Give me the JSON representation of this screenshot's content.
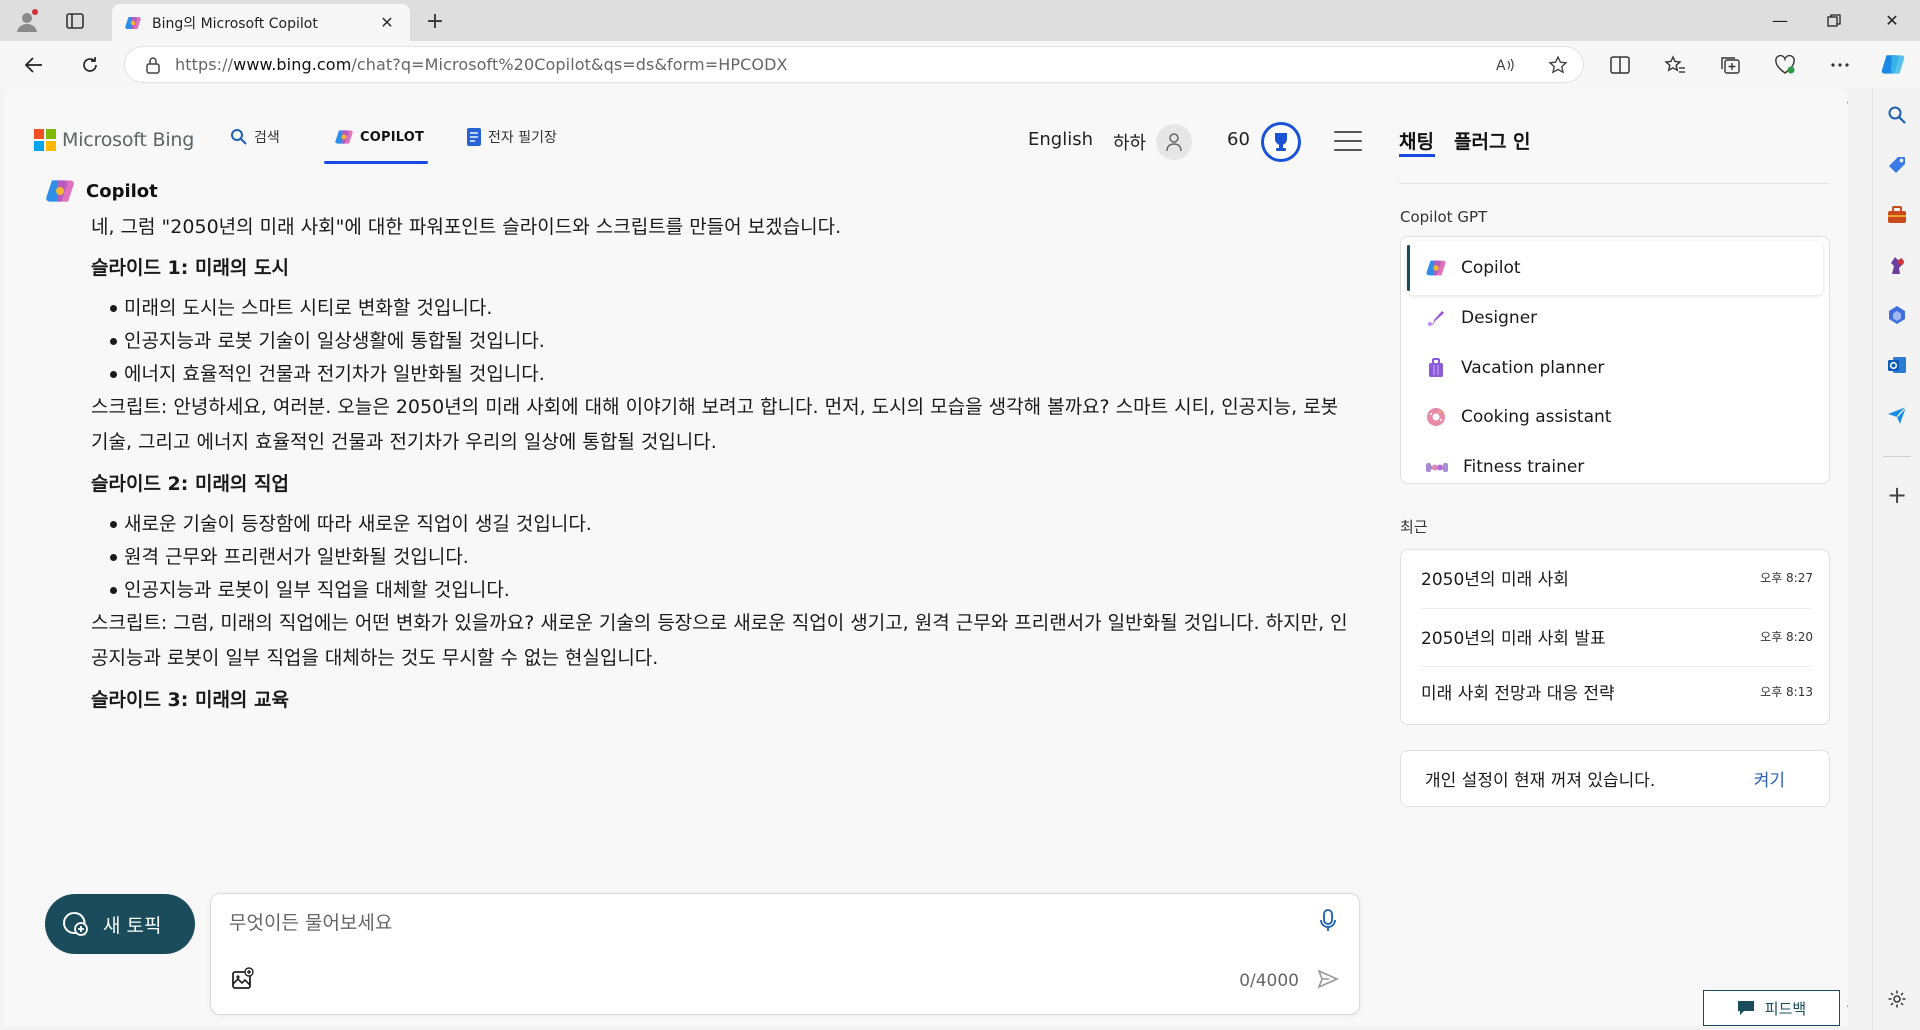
{
  "browser": {
    "tab_title": "Bing의 Microsoft Copilot",
    "url_prefix": "https://",
    "url_domain": "www.bing.com",
    "url_path": "/chat?q=Microsoft%20Copilot&qs=ds&form=HPCODX"
  },
  "header": {
    "logo_text": "Microsoft Bing",
    "nav": {
      "search": "검색",
      "copilot": "COPILOT",
      "notebook": "전자 필기장"
    },
    "language": "English",
    "user_name": "하하",
    "points": "60"
  },
  "chat": {
    "bot_name": "Copilot",
    "intro": "네, 그럼 \"2050년의 미래 사회\"에 대한 파워포인트 슬라이드와 스크립트를 만들어 보겠습니다.",
    "slide1_title": "슬라이드 1: 미래의 도시",
    "slide1_bullets": [
      "미래의 도시는 스마트 시티로 변화할 것입니다.",
      "인공지능과 로봇 기술이 일상생활에 통합될 것입니다.",
      "에너지 효율적인 건물과 전기차가 일반화될 것입니다."
    ],
    "slide1_script": "스크립트: 안녕하세요, 여러분. 오늘은 2050년의 미래 사회에 대해 이야기해 보려고 합니다. 먼저, 도시의 모습을 생각해 볼까요? 스마트 시티, 인공지능, 로봇 기술, 그리고 에너지 효율적인 건물과 전기차가 우리의 일상에 통합될 것입니다.",
    "slide2_title": "슬라이드 2: 미래의 직업",
    "slide2_bullets": [
      "새로운 기술이 등장함에 따라 새로운 직업이 생길 것입니다.",
      "원격 근무와 프리랜서가 일반화될 것입니다.",
      "인공지능과 로봇이 일부 직업을 대체할 것입니다."
    ],
    "slide2_script": "스크립트: 그럼, 미래의 직업에는 어떤 변화가 있을까요? 새로운 기술의 등장으로 새로운 직업이 생기고, 원격 근무와 프리랜서가 일반화될 것입니다. 하지만, 인공지능과 로봇이 일부 직업을 대체하는 것도 무시할 수 없는 현실입니다.",
    "slide3_title": "슬라이드 3: 미래의 교육"
  },
  "composer": {
    "new_topic": "새 토픽",
    "placeholder": "무엇이든 물어보세요",
    "char_count": "0/4000"
  },
  "right_panel": {
    "tabs": [
      "채팅",
      "플러그 인"
    ],
    "gpt_section": "Copilot GPT",
    "gpts": [
      "Copilot",
      "Designer",
      "Vacation planner",
      "Cooking assistant",
      "Fitness trainer"
    ],
    "recent_section": "최근",
    "recent": [
      {
        "title": "2050년의 미래 사회",
        "time": "오후 8:27"
      },
      {
        "title": "2050년의 미래 사회 발표",
        "time": "오후 8:20"
      },
      {
        "title": "미래 사회 전망과 대응 전략",
        "time": "오후 8:13"
      }
    ],
    "privacy_text": "개인 설정이 현재 꺼져 있습니다.",
    "privacy_action": "켜기"
  },
  "feedback": "피드백",
  "colors": {
    "accent": "#174ae4",
    "teal": "#1b4c5c",
    "link": "#2b5fb8"
  }
}
